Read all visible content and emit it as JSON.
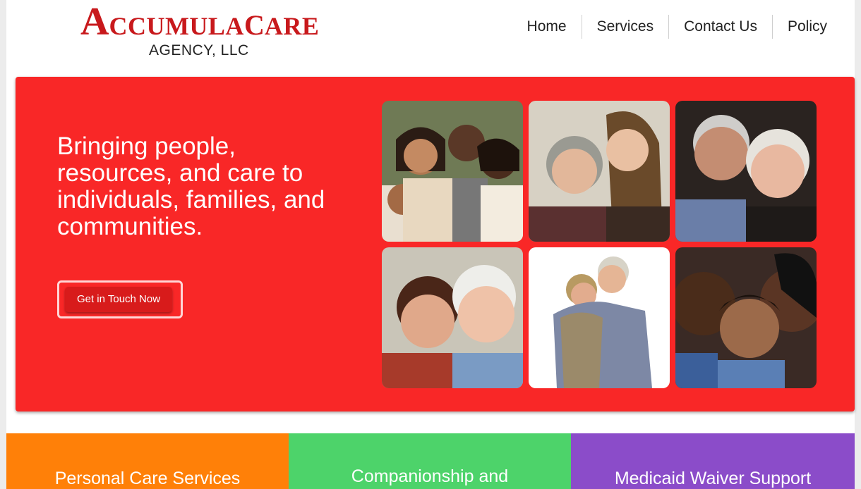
{
  "brand": {
    "logo_first_letter": "A",
    "logo_word1": "CCUMULA",
    "logo_word2_first": "C",
    "logo_word2_rest": "ARE",
    "logo_subline": "AGENCY, LLC",
    "logo_color": "#c8191c"
  },
  "nav": {
    "items": [
      "Home",
      "Services",
      "Contact Us",
      "Policy"
    ]
  },
  "hero": {
    "heading": "Bringing people, resources, and care to individuals, families, and communities.",
    "cta_label": "Get in Touch Now",
    "background_color": "#f92727",
    "photos": [
      "family-group-photo",
      "older-woman-and-young-woman-photo",
      "elderly-couple-photo",
      "two-older-women-photo",
      "embracing-elderly-couple-photo",
      "smiling-family-photo"
    ]
  },
  "services": [
    {
      "title": "Personal Care Services",
      "color": "#ff8008"
    },
    {
      "title": "Companionship and",
      "color": "#4dd36a"
    },
    {
      "title": "Medicaid Waiver Support",
      "color": "#8b4cc9"
    }
  ]
}
